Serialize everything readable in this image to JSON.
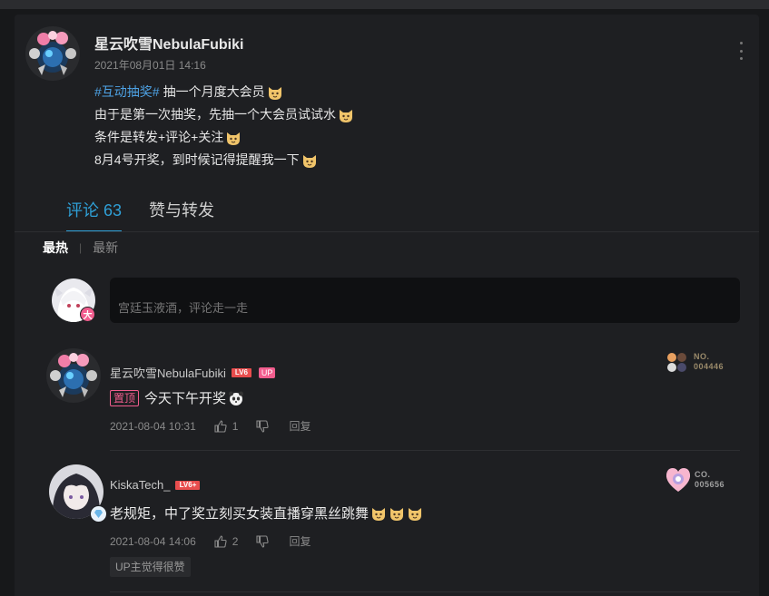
{
  "post": {
    "author": "星云吹雪NebulaFubiki",
    "time": "2021年08月01日 14:16",
    "hashtag": "#互动抽奖#",
    "lines": [
      "抽一个月度大会员",
      "由于是第一次抽奖，先抽一个大会员试试水",
      "条件是转发+评论+关注",
      "8月4号开奖，到时候记得提醒我一下"
    ]
  },
  "tabs": {
    "comments": "评论 63",
    "likes_reposts": "赞与转发"
  },
  "sort": {
    "hot": "最热",
    "new": "最新"
  },
  "composer": {
    "placeholder": "宫廷玉液酒，评论走一走",
    "badge": "大"
  },
  "comments": [
    {
      "author": "星云吹雪NebulaFubiki",
      "level": "LV6",
      "up_tag": "UP",
      "pin_tag": "置顶",
      "text": "今天下午开奖",
      "time": "2021-08-04 10:31",
      "likes": "1",
      "reply": "回复",
      "fan_label_1": "NO.",
      "fan_label_2": "004446"
    },
    {
      "author": "KiskaTech_",
      "level": "LV6+",
      "text": "老规矩，中了奖立刻买女装直播穿黑丝跳舞",
      "time": "2021-08-04 14:06",
      "likes": "2",
      "reply": "回复",
      "fan_label_1": "CO.",
      "fan_label_2": "005656",
      "up_liked": "UP主觉得很赞"
    }
  ],
  "colors": {
    "accent": "#2f9fd6",
    "pink": "#f25d8e",
    "hashtag": "#4ea3e6"
  }
}
